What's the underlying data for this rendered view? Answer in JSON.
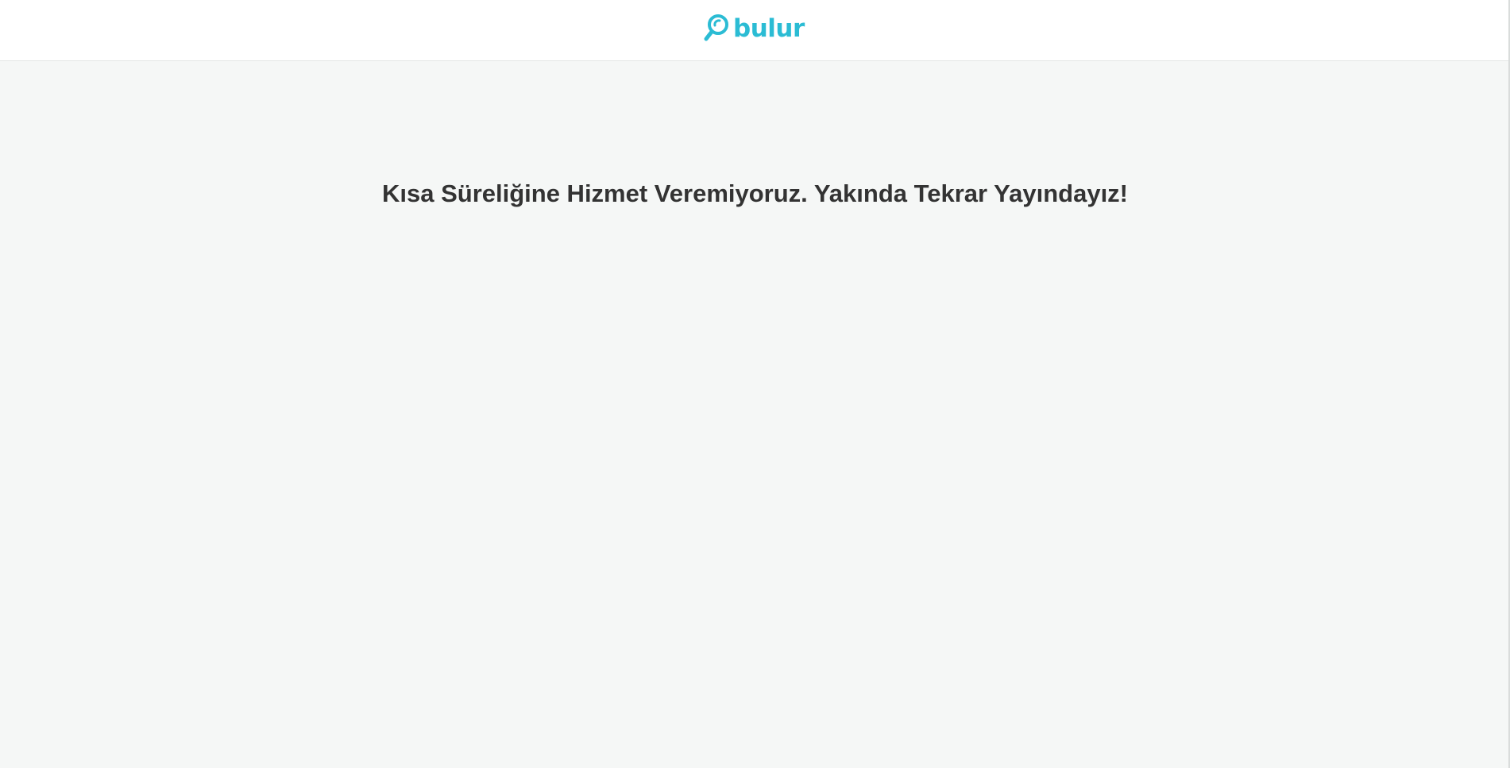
{
  "brand": {
    "name": "bulur",
    "color": "#2bbcd4"
  },
  "main": {
    "message": "Kısa Süreliğine Hizmet Veremiyoruz. Yakında Tekrar Yayındayız!",
    "text_color": "#333333",
    "background": "#f5f7f6"
  },
  "icons": {
    "logo_icon": "magnifier-icon"
  }
}
